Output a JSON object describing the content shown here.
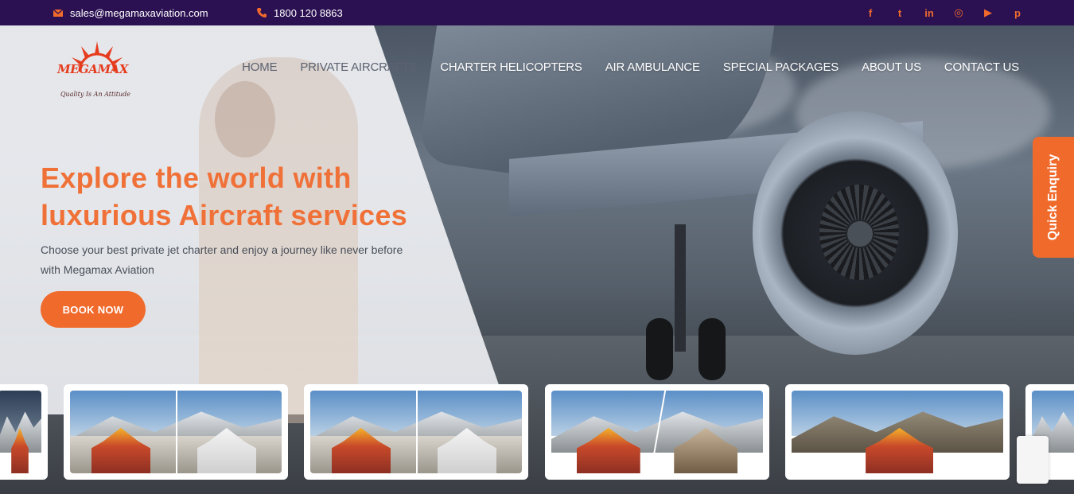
{
  "topbar": {
    "email": "sales@megamaxaviation.com",
    "phone": "1800 120 8863",
    "social": [
      {
        "icon": "facebook-icon",
        "glyph": "f"
      },
      {
        "icon": "twitter-icon",
        "glyph": "t"
      },
      {
        "icon": "linkedin-icon",
        "glyph": "in"
      },
      {
        "icon": "instagram-icon",
        "glyph": "◎"
      },
      {
        "icon": "youtube-icon",
        "glyph": "▶"
      },
      {
        "icon": "pinterest-icon",
        "glyph": "p"
      }
    ]
  },
  "logo": {
    "word": "MEGAMAX",
    "tagline": "Quality Is An Attitude"
  },
  "nav": {
    "items": [
      {
        "label": "HOME"
      },
      {
        "label": "PRIVATE AIRCRAFTS"
      },
      {
        "label": "CHARTER HELICOPTERS"
      },
      {
        "label": "AIR AMBULANCE"
      },
      {
        "label": "SPECIAL PACKAGES"
      },
      {
        "label": "ABOUT US"
      },
      {
        "label": "CONTACT US"
      }
    ]
  },
  "hero": {
    "title_line1": "Explore the world with",
    "title_line2": "luxurious Aircraft services",
    "subtitle_line1": "Choose your best private jet charter and enjoy a journey like never before",
    "subtitle_line2": "with Megamax Aviation",
    "cta": "BOOK NOW"
  },
  "quick_enquiry": "Quick Enquiry",
  "colors": {
    "topbar": "#2b1152",
    "accent": "#f06a2c",
    "title": "#f07138"
  }
}
